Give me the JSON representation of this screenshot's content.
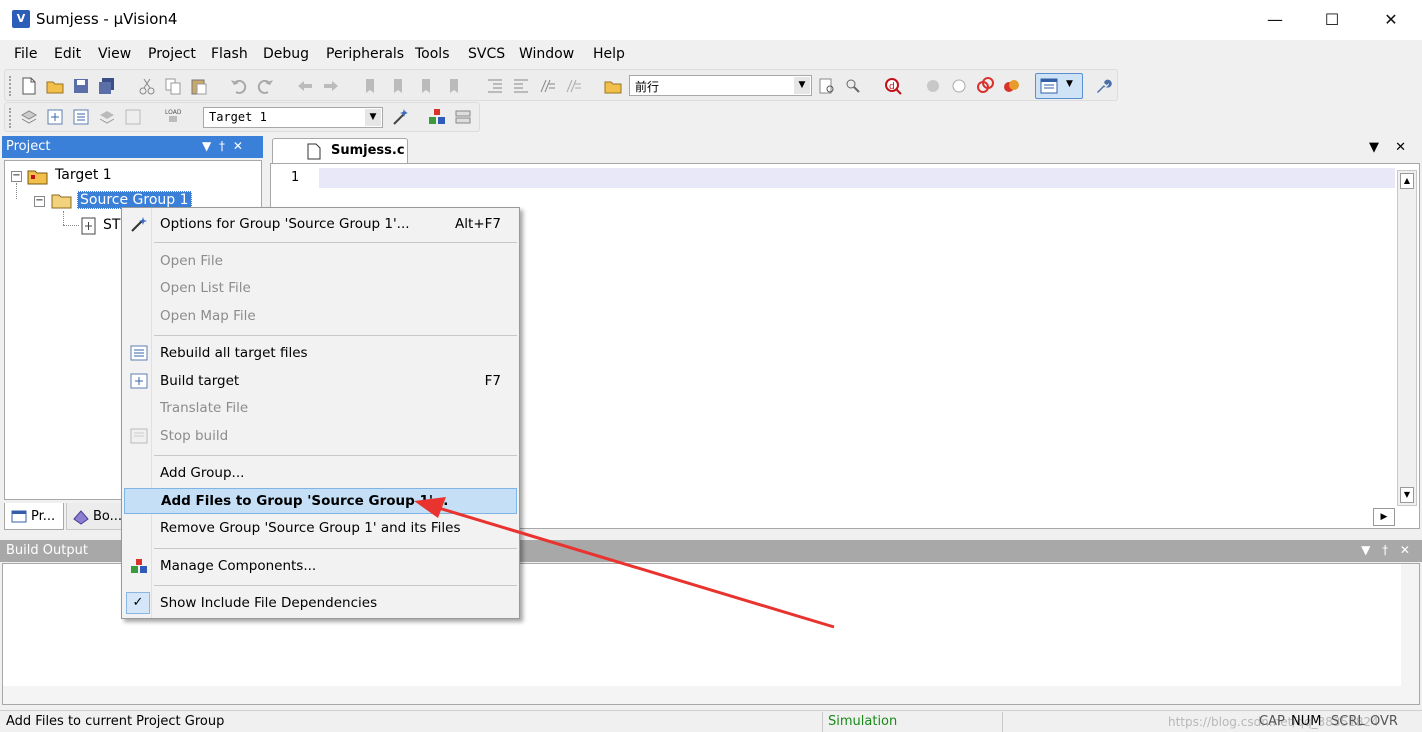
{
  "window": {
    "title": "Sumjess  - µVision4",
    "app_icon_glyph": "V",
    "minimize_glyph": "—",
    "maximize_glyph": "☐",
    "close_glyph": "✕"
  },
  "menu": [
    "File",
    "Edit",
    "View",
    "Project",
    "Flash",
    "Debug",
    "Peripherals",
    "Tools",
    "SVCS",
    "Window",
    "Help"
  ],
  "toolbar": {
    "find_combo_value": "前行",
    "target_combo_value": "Target 1",
    "dropdown_glyph": "▼"
  },
  "project_panel": {
    "title": "Project",
    "pin_glyph": "▼ † ✕",
    "tree": {
      "target": "Target 1",
      "group": "Source Group 1",
      "file_partial": "ST"
    },
    "bottom_tabs": [
      "Pr...",
      "Bo..."
    ]
  },
  "editor": {
    "tab_label": "Sumjess.c",
    "line_number": "1",
    "tab_controls": "▼ ✕"
  },
  "build_output": {
    "title": "Build Output",
    "controls": "▼ † ✕"
  },
  "context_menu": {
    "items": [
      {
        "label": "Options for Group 'Source Group 1'...",
        "shortcut": "Alt+F7",
        "disabled": false
      },
      {
        "label": "Open File",
        "shortcut": "",
        "disabled": true
      },
      {
        "label": "Open List File",
        "shortcut": "",
        "disabled": true
      },
      {
        "label": "Open Map File",
        "shortcut": "",
        "disabled": true
      },
      {
        "label": "Rebuild all target files",
        "shortcut": "",
        "disabled": false
      },
      {
        "label": "Build target",
        "shortcut": "F7",
        "disabled": false
      },
      {
        "label": "Translate File",
        "shortcut": "",
        "disabled": true
      },
      {
        "label": "Stop build",
        "shortcut": "",
        "disabled": true
      },
      {
        "label": "Add Group...",
        "shortcut": "",
        "disabled": false
      },
      {
        "label": "Add Files to Group 'Source Group 1'...",
        "shortcut": "",
        "disabled": false,
        "highlighted": true
      },
      {
        "label": "Remove Group 'Source Group 1' and its Files",
        "shortcut": "",
        "disabled": false
      },
      {
        "label": "Manage Components...",
        "shortcut": "",
        "disabled": false
      },
      {
        "label": "Show Include File Dependencies",
        "shortcut": "",
        "disabled": false,
        "checked": true
      }
    ],
    "check_glyph": "✓"
  },
  "status_bar": {
    "message": "Add Files to current Project Group",
    "mode": "Simulation",
    "indicators": [
      "CAP",
      "NUM",
      "SCRL",
      "OVR"
    ],
    "watermark": "https://blog.csdn.net/qq_38351824"
  },
  "colors": {
    "selection_blue": "#3a7fd8",
    "menu_highlight": "#c5e0f6",
    "arrow_red": "#e8332f",
    "simulation_green": "#1a8a1a"
  }
}
